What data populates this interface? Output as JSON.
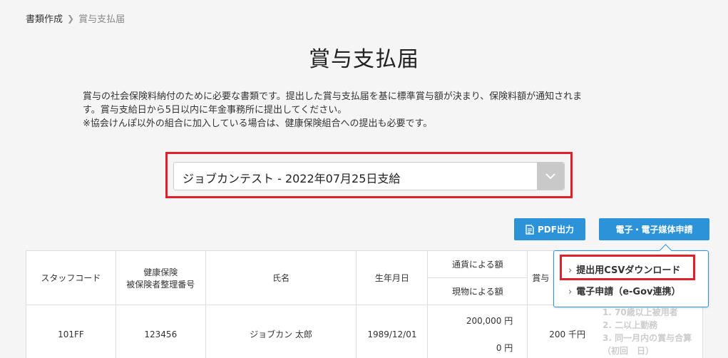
{
  "breadcrumb": {
    "parent": "書類作成",
    "current": "賞与支払届"
  },
  "page_title": "賞与支払届",
  "description": {
    "line1": "賞与の社会保険料納付のために必要な書類です。提出した賞与支払届を基に標準賞与額が決まり、保険料額が通知されま",
    "line2": "す。賞与支給日から5日以内に年金事務所に提出してください。",
    "line3": "※協会けんぽ以外の組合に加入している場合は、健康保険組合への提出も必要です。"
  },
  "bonus_select": {
    "value": "ジョブカンテスト - 2022年07月25日支給"
  },
  "buttons": {
    "pdf": "PDF出力",
    "egov": "電子・電子媒体申請"
  },
  "dropdown": {
    "csv": "提出用CSVダウンロード",
    "egov": "電子申請（e-Gov連携）"
  },
  "table": {
    "headers": {
      "staff_code": "スタッフコード",
      "insurance_line1": "健康保険",
      "insurance_line2": "被保険者整理番号",
      "name": "氏名",
      "birth": "生年月日",
      "currency": "通貨による額",
      "goods": "現物による額",
      "bonus_partial": "賞与"
    },
    "rows": [
      {
        "staff_code": "101FF",
        "insurance_no": "123456",
        "name": "ジョブカン 太郎",
        "birth": "1989/12/01",
        "currency_amount": "200,000 円",
        "goods_amount": "0 円",
        "bonus_total": "200 千円"
      }
    ]
  },
  "notes": [
    "1. 70歳以上被用者",
    "2. 二以上勤務",
    "3. 同一月内の賞与合算",
    "（初回　日）"
  ],
  "colors": {
    "primary": "#2d93d8",
    "highlight": "#e0202a"
  }
}
